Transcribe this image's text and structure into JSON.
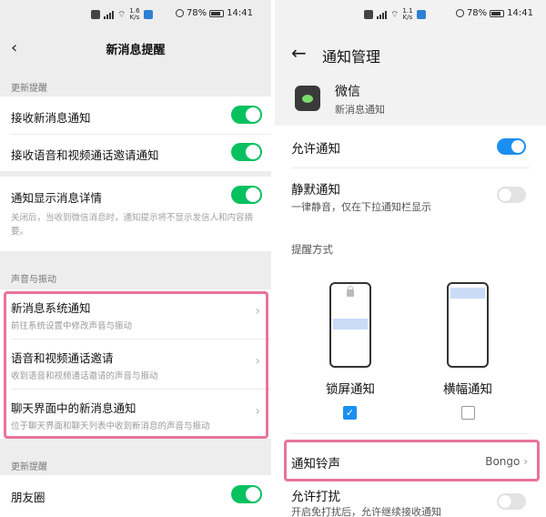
{
  "left": {
    "status": {
      "speed_value": "1.6",
      "speed_unit": "K/s",
      "battery": "78%",
      "time": "14:41"
    },
    "header": {
      "title": "新消息提醒"
    },
    "section1": {
      "label": "更新提醒",
      "items": [
        {
          "label": "接收新消息通知",
          "on": true
        },
        {
          "label": "接收语音和视频通话邀请通知",
          "on": true
        }
      ]
    },
    "detail": {
      "label": "通知显示消息详情",
      "desc": "关闭后，当收到微信消息时，通知提示将不显示发信人和内容摘要。",
      "on": true
    },
    "section2": {
      "label": "声音与振动",
      "items": [
        {
          "title": "新消息系统通知",
          "sub": "前往系统设置中修改声音与振动"
        },
        {
          "title": "语音和视频通话邀请",
          "sub": "收到语音和视频通话邀请的声音与振动"
        },
        {
          "title": "聊天界面中的新消息通知",
          "sub": "位于聊天界面和聊天列表中收到新消息的声音与振动"
        }
      ]
    },
    "section3": {
      "label": "更新提醒",
      "items": [
        {
          "label": "朋友圈",
          "on": true
        }
      ]
    }
  },
  "right": {
    "status": {
      "speed_value": "1.1",
      "speed_unit": "K/s",
      "battery": "78%",
      "time": "14:41"
    },
    "header": {
      "title": "通知管理"
    },
    "app": {
      "name": "微信",
      "subtitle": "新消息通知"
    },
    "allow": {
      "label": "允许通知",
      "on": true
    },
    "silent": {
      "label": "静默通知",
      "desc": "一律静音，仅在下拉通知栏显示",
      "on": false
    },
    "reminder": {
      "label": "提醒方式",
      "options": [
        {
          "label": "锁屏通知",
          "checked": true
        },
        {
          "label": "横幅通知",
          "checked": false
        }
      ]
    },
    "ringtone": {
      "label": "通知铃声",
      "value": "Bongo"
    },
    "dnd": {
      "label": "允许打扰",
      "desc": "开启免打扰后，允许继续接收通知",
      "on": false
    }
  },
  "colors": {
    "wechat_green": "#07c160",
    "emui_blue": "#1b8ff0",
    "highlight_pink": "#e8749a"
  }
}
